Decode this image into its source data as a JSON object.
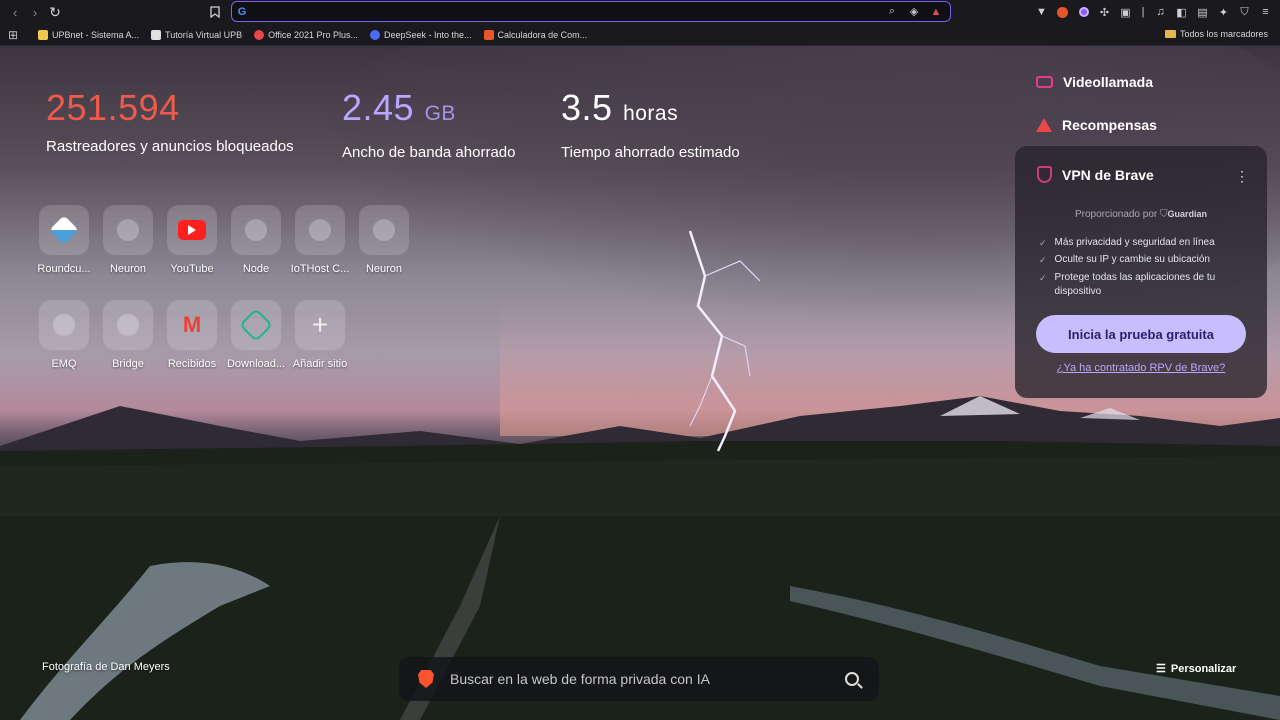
{
  "browser": {
    "url_value": "",
    "bookmarks": [
      {
        "label": "UPBnet - Sistema A...",
        "color": "#f2c94c"
      },
      {
        "label": "Tutoría Virtual UPB",
        "color": "#e0e0e0"
      },
      {
        "label": "Office 2021 Pro Plus...",
        "color": "#e84848"
      },
      {
        "label": "DeepSeek - Into the...",
        "color": "#4a6cf7"
      },
      {
        "label": "Calculadora de Com...",
        "color": "#e8552a"
      }
    ],
    "all_bookmarks": "Todos los marcadores"
  },
  "stats": {
    "trackers": {
      "value": "251.594",
      "label": "Rastreadores y anuncios bloqueados"
    },
    "bandwidth": {
      "value": "2.45",
      "unit": "GB",
      "label": "Ancho de banda ahorrado"
    },
    "time": {
      "value": "3.5",
      "unit": "horas",
      "label": "Tiempo ahorrado estimado"
    }
  },
  "top_sites": [
    {
      "name": "Roundcu...",
      "icon": "roundcube-icon"
    },
    {
      "name": "Neuron",
      "icon": "globe-icon"
    },
    {
      "name": "YouTube",
      "icon": "youtube-icon"
    },
    {
      "name": "Node",
      "icon": "globe-icon"
    },
    {
      "name": "IoTHost C...",
      "icon": "globe-icon"
    },
    {
      "name": "Neuron",
      "icon": "globe-icon"
    },
    {
      "name": "EMQ",
      "icon": "globe-icon"
    },
    {
      "name": "Bridge",
      "icon": "globe-icon"
    },
    {
      "name": "Recibidos",
      "icon": "gmail-icon"
    },
    {
      "name": "Download...",
      "icon": "download-icon"
    },
    {
      "name": "Añadir sitio",
      "icon": "plus-icon"
    }
  ],
  "panel": {
    "videocall": "Videollamada",
    "rewards": "Recompensas",
    "vpn": {
      "title": "VPN de Brave",
      "provided_by": "Proporcionado por",
      "provider": "Guardian",
      "features": [
        "Más privacidad y seguridad en línea",
        "Oculte su IP y cambie su ubicación",
        "Protege todas las aplicaciones de tu dispositivo"
      ],
      "trial_button": "Inicia la prueba gratuita",
      "contracted_link": "¿Ya ha contratado RPV de Brave?"
    }
  },
  "footer": {
    "photo_credit": "Fotografía de Dan Meyers",
    "search_placeholder": "Buscar en la web de forma privada con IA",
    "customize": "Personalizar"
  }
}
